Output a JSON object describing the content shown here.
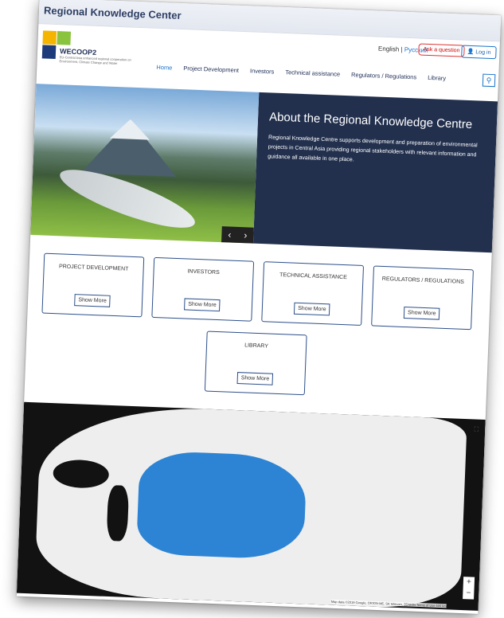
{
  "window": {
    "title": "Regional Knowledge Center"
  },
  "brand": {
    "name": "WECOOP2",
    "subtitle": "EU-Central Asia enhanced regional cooperation on Environment, Climate Change and Water",
    "colors": [
      "#2d6fb5",
      "#8ac43f",
      "#f4b400",
      "#1d3b7a"
    ]
  },
  "header": {
    "lang_en": "English",
    "lang_sep": "|",
    "lang_ru": "Русский",
    "ask_label": "Ask a question",
    "login_label": "Log in",
    "search_icon": "search-icon"
  },
  "nav": [
    "Home",
    "Project Development",
    "Investors",
    "Technical assistance",
    "Regulators / Regulations",
    "Library"
  ],
  "hero": {
    "title": "About the Regional Knowledge Centre",
    "text": "Regional Knowledge Centre supports development and preparation of environmental projects in Central Asia providing regional stakeholders with relevant information and guidance all available in one place.",
    "prev_icon": "‹",
    "next_icon": "›"
  },
  "cards": [
    {
      "title": "PROJECT DEVELOPMENT",
      "button": "Show More"
    },
    {
      "title": "INVESTORS",
      "button": "Show More"
    },
    {
      "title": "TECHNICAL ASSISTANCE",
      "button": "Show More"
    },
    {
      "title": "REGULATORS / REGULATIONS",
      "button": "Show More"
    },
    {
      "title": "LIBRARY",
      "button": "Show More"
    }
  ],
  "map": {
    "highlight_color": "#2d84d4",
    "zoom_in": "+",
    "zoom_out": "−",
    "attribution": "Map data ©2019 Google, ORION-ME, SK telecom, ZENRIN  Terms of Use  500 km"
  }
}
